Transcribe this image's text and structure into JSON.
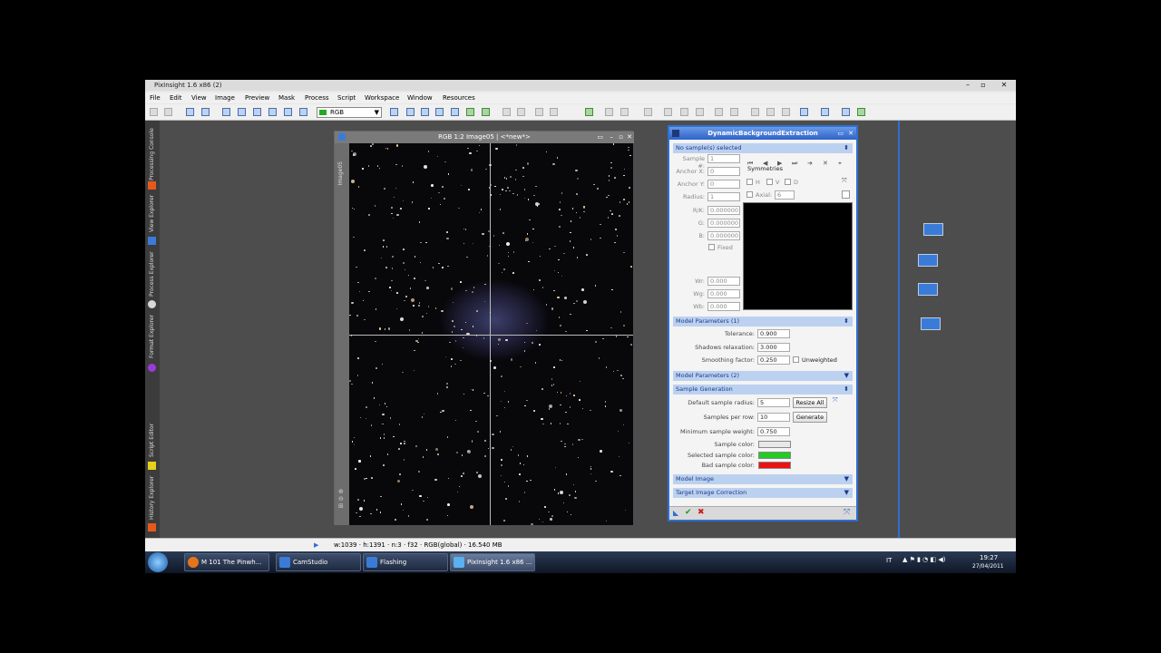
{
  "app": {
    "title": "PixInsight 1.6 x86 (2)"
  },
  "menu": [
    "File",
    "Edit",
    "View",
    "Image",
    "Preview",
    "Mask",
    "Process",
    "Script",
    "Workspace",
    "Window",
    "Resources"
  ],
  "toolbar": {
    "color_space": "RGB"
  },
  "left_panel": [
    "Processing Console",
    "View Explorer",
    "Process Explorer",
    "Format Explorer",
    "Script Editor",
    "History Explorer"
  ],
  "image_window": {
    "title": "RGB 1:2 Image05 | <*new*>",
    "side_label": "Image05"
  },
  "dbe": {
    "title": "DynamicBackgroundExtraction",
    "samples_header": "No sample(s) selected",
    "sample_no_label": "Sample #:",
    "sample_no": "1",
    "anchor_x_label": "Anchor X:",
    "anchor_x": "0",
    "anchor_y_label": "Anchor Y:",
    "anchor_y": "0",
    "radius_label": "Radius:",
    "radius": "1",
    "symmetries_label": "Symmetries",
    "sym_h": "H",
    "sym_v": "V",
    "sym_d": "D",
    "axial_label": "Axial:",
    "axial": "6",
    "rk_label": "R/K:",
    "rk": "0.000000",
    "g_label": "G:",
    "g": "0.000000",
    "b_label": "B:",
    "b": "0.000000",
    "fixed_label": "Fixed",
    "wr_label": "Wr:",
    "wr": "0.000",
    "wg_label": "Wg:",
    "wg": "0.000",
    "wb_label": "Wb:",
    "wb": "0.000",
    "model1_header": "Model Parameters (1)",
    "tolerance_label": "Tolerance:",
    "tolerance": "0.900",
    "shadows_label": "Shadows relaxation:",
    "shadows": "3.000",
    "smoothing_label": "Smoothing factor:",
    "smoothing": "0.250",
    "unweighted_label": "Unweighted",
    "model2_header": "Model Parameters (2)",
    "samplegen_header": "Sample Generation",
    "default_radius_label": "Default sample radius:",
    "default_radius": "5",
    "resize_all": "Resize All",
    "samples_row_label": "Samples per row:",
    "samples_row": "10",
    "generate": "Generate",
    "min_weight_label": "Minimum sample weight:",
    "min_weight": "0.750",
    "sample_color_label": "Sample color:",
    "selected_color_label": "Selected sample color:",
    "bad_color_label": "Bad sample color:",
    "model_image_header": "Model Image",
    "target_header": "Target Image Correction",
    "colors": {
      "sample": "#e8e8e8",
      "selected": "#22cc22",
      "bad": "#ee1111"
    }
  },
  "status": {
    "text": "w:1039 · h:1391 · n:3 · f32 · RGB(global) · 16.540 MB"
  },
  "taskbar": {
    "items": [
      "M 101 The Pinwh...",
      "CamStudio",
      "Flashing",
      "PixInsight 1.6 x86 ..."
    ],
    "lang": "IT",
    "time": "19:27",
    "date": "27/04/2011"
  }
}
